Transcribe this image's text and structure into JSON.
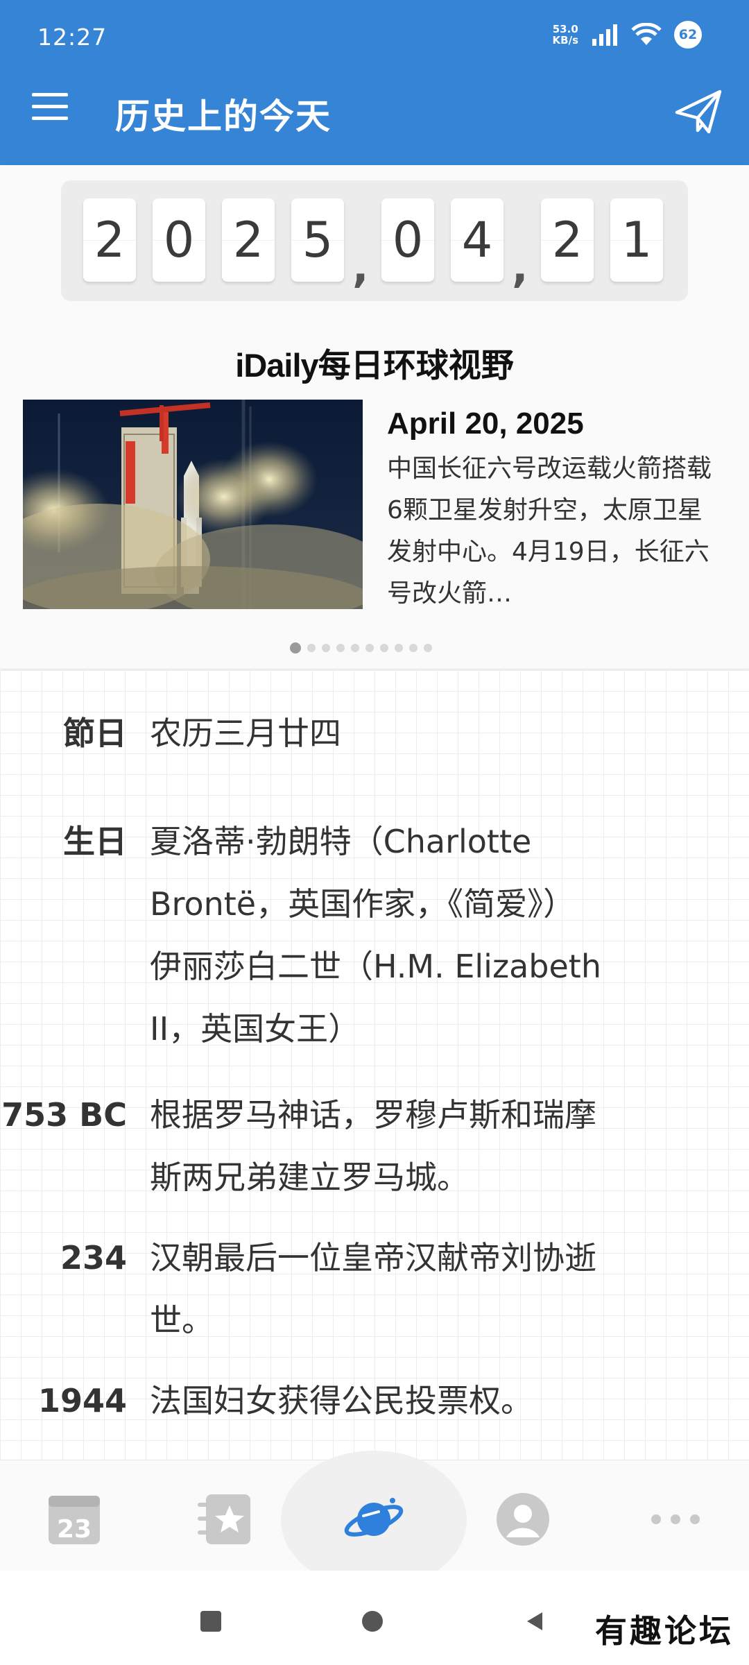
{
  "status_bar": {
    "time": "12:27",
    "net_speed_value": "53.0",
    "net_speed_unit": "KB/s",
    "battery": "62"
  },
  "app_bar": {
    "title": "历史上的今天"
  },
  "date": {
    "digits": [
      "2",
      "0",
      "2",
      "5",
      "0",
      "4",
      "2",
      "1"
    ],
    "separator": ","
  },
  "brand": {
    "part1": "iDaily",
    "part2": "每日环球视野"
  },
  "news": {
    "date": "April 20, 2025",
    "text": "中国长征六号改运载火箭搭载6颗卫星发射升空，太原卫星发射中心。4月19日，长征六号改火箭…",
    "page_count": 10,
    "active_page": 1
  },
  "events": [
    {
      "label": "節日",
      "lines": [
        "农历三月廿四"
      ]
    },
    {
      "label": "生日",
      "lines": [
        "夏洛蒂·勃朗特（Charlotte",
        "Brontë，英国作家，《简爱》）",
        "伊丽莎白二世（H.M. Elizabeth",
        "II，英国女王）"
      ]
    },
    {
      "label": "753 BC",
      "lines": [
        "根据罗马神话，罗穆卢斯和瑞摩",
        "斯两兄弟建立罗马城。"
      ]
    },
    {
      "label": "234",
      "lines": [
        "汉朝最后一位皇帝汉献帝刘协逝",
        "世。"
      ]
    },
    {
      "label": "1944",
      "lines": [
        "法国妇女获得公民投票权。"
      ]
    }
  ],
  "bottom_nav": {
    "calendar_day": "23",
    "items": [
      "calendar-icon",
      "favorites-icon",
      "planet-icon",
      "profile-icon",
      "more-icon"
    ],
    "active": "planet-icon"
  },
  "watermark": "有趣论坛",
  "colors": {
    "primary": "#3584d6",
    "planet": "#2f7fdc"
  }
}
